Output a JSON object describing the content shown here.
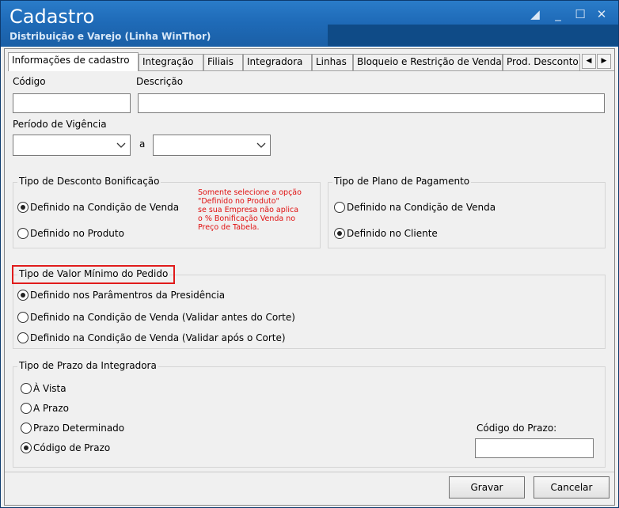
{
  "window": {
    "title": "Cadastro",
    "subtitle": "Distribuição e Varejo (Linha WinThor)",
    "controls": [
      "restore-icon",
      "minimize-icon",
      "maximize-icon",
      "close-icon"
    ]
  },
  "tabs": [
    {
      "label": "Informações de cadastro",
      "active": true
    },
    {
      "label": "Integração"
    },
    {
      "label": "Filiais"
    },
    {
      "label": "Integradora"
    },
    {
      "label": "Linhas"
    },
    {
      "label": "Bloqueio e Restrição de Venda"
    },
    {
      "label": "Prod. Desconto"
    }
  ],
  "form": {
    "codigo_label": "Código",
    "codigo_value": "",
    "descricao_label": "Descrição",
    "descricao_value": "",
    "periodo_label": "Período de Vigência",
    "periodo_sep": "a",
    "periodo_inicio": "",
    "periodo_fim": ""
  },
  "desconto": {
    "title": "Tipo de Desconto Bonificação",
    "options": [
      {
        "label": "Definido na Condição de Venda",
        "selected": true
      },
      {
        "label": "Definido no Produto",
        "selected": false
      }
    ],
    "note_lines": [
      "Somente selecione a opção",
      "\"Definido no Produto\"",
      "se sua Empresa não aplica",
      "o % Bonificação Venda no",
      "Preço de Tabela."
    ]
  },
  "plano": {
    "title": "Tipo de Plano de Pagamento",
    "options": [
      {
        "label": "Definido na Condição de Venda",
        "selected": false
      },
      {
        "label": "Definido no Cliente",
        "selected": true
      }
    ]
  },
  "valor_minimo": {
    "title": "Tipo de Valor Mínimo do Pedido",
    "options": [
      {
        "label": "Definido nos Parâmentros da Presidência",
        "selected": true
      },
      {
        "label": "Definido na Condição  de Venda (Validar antes do Corte)",
        "selected": false
      },
      {
        "label": "Definido na Condição de Venda (Validar após o Corte)",
        "selected": false
      }
    ]
  },
  "prazo": {
    "title": "Tipo de Prazo da Integradora",
    "options": [
      {
        "label": "À Vista",
        "selected": false
      },
      {
        "label": "A Prazo",
        "selected": false
      },
      {
        "label": "Prazo Determinado",
        "selected": false
      },
      {
        "label": "Código de Prazo",
        "selected": true
      }
    ],
    "codigo_label": "Código do Prazo:",
    "codigo_value": ""
  },
  "buttons": {
    "gravar": "Gravar",
    "cancelar": "Cancelar"
  },
  "colors": {
    "titlebar": "#1f6bb8",
    "note": "#e01010",
    "highlight": "#e01b1b"
  }
}
